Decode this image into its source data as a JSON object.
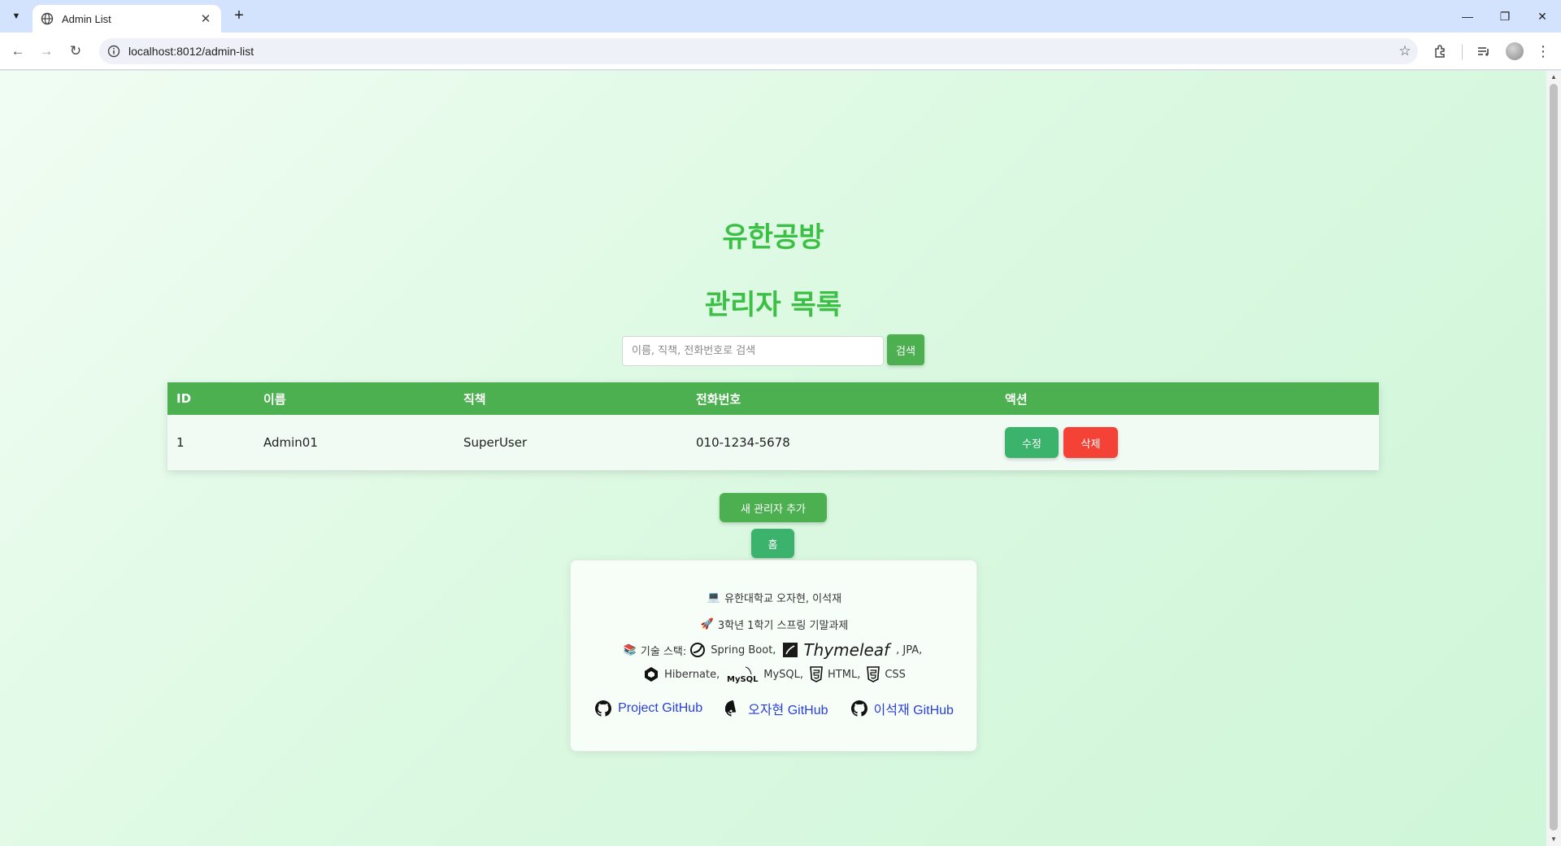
{
  "browser": {
    "tab_title": "Admin List",
    "url": "localhost:8012/admin-list",
    "tab_close": "✕",
    "new_tab": "+"
  },
  "page": {
    "brand": "유한공방",
    "heading": "관리자 목록",
    "search": {
      "placeholder": "이름, 직책, 전화번호로 검색",
      "button": "검색"
    },
    "table": {
      "headers": [
        "ID",
        "이름",
        "직책",
        "전화번호",
        "액션"
      ],
      "rows": [
        {
          "id": "1",
          "name": "Admin01",
          "title": "SuperUser",
          "phone": "010-1234-5678",
          "edit": "수정",
          "delete": "삭제"
        }
      ]
    },
    "add_button": "새 관리자 추가",
    "home_button": "홈"
  },
  "footer": {
    "authors_emoji": "💻",
    "authors": "유한대학교 오자현, 이석재",
    "project_emoji": "🚀",
    "project": "3학년 1학기 스프링 기말과제",
    "stack_emoji": "📚",
    "stack_label": "기술 스택:",
    "stack": {
      "spring": "Spring Boot,",
      "thymeleaf": "Thymeleaf",
      "jpa": ", JPA,",
      "hibernate": "Hibernate,",
      "mysql_logo": "MySQL",
      "mysql": "MySQL,",
      "html": "HTML,",
      "css": "CSS"
    },
    "links": [
      {
        "label": "Project GitHub"
      },
      {
        "label": "오자현 GitHub"
      },
      {
        "label": "이석재 GitHub"
      }
    ]
  },
  "colors": {
    "accent_green": "#4caf50",
    "brand_green": "#3cbf45",
    "edit_green": "#3cb36c",
    "delete_red": "#f44336",
    "link_blue": "#2a3fd6"
  }
}
